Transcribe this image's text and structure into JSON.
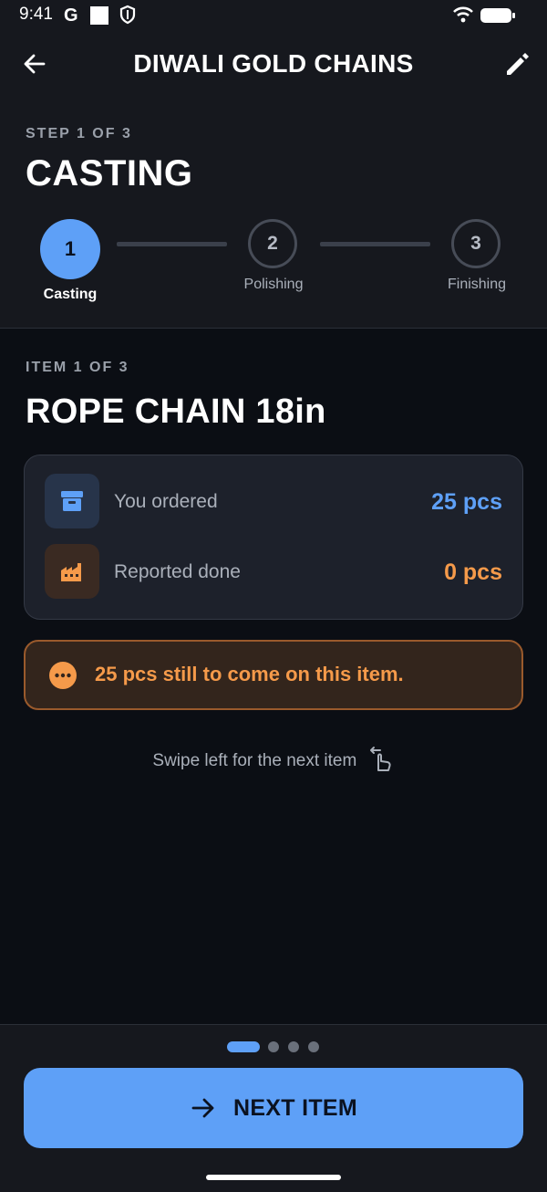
{
  "status_bar": {
    "time": "9:41",
    "icons": [
      "google-g-icon",
      "square-notification-icon",
      "shield-icon",
      "wifi-icon",
      "battery-icon"
    ]
  },
  "app_bar": {
    "title": "DIWALI GOLD CHAINS",
    "back_icon": "arrow-left-icon",
    "edit_icon": "pencil-icon"
  },
  "step": {
    "label": "STEP 1 OF 3",
    "title": "CASTING",
    "steps": [
      {
        "number": "1",
        "name": "Casting",
        "active": true
      },
      {
        "number": "2",
        "name": "Polishing",
        "active": false
      },
      {
        "number": "3",
        "name": "Finishing",
        "active": false
      }
    ]
  },
  "item": {
    "label": "ITEM 1 OF 3",
    "title": "ROPE CHAIN 18in"
  },
  "quantities": {
    "ordered_label": "You ordered",
    "ordered_value": "25 pcs",
    "done_label": "Reported done",
    "done_value": "0 pcs"
  },
  "banner": {
    "text": "25 pcs still to come on this item.",
    "icon": "more-dots-icon"
  },
  "swipe_hint": "Swipe left for the next item",
  "pager": {
    "total": 4,
    "current": 1
  },
  "next_button": {
    "label": "NEXT ITEM",
    "icon": "arrow-right-icon"
  },
  "colors": {
    "accent": "#5ea0f7",
    "warning": "#f59a4a",
    "background": "#0b0e14",
    "surface": "#16181e"
  }
}
